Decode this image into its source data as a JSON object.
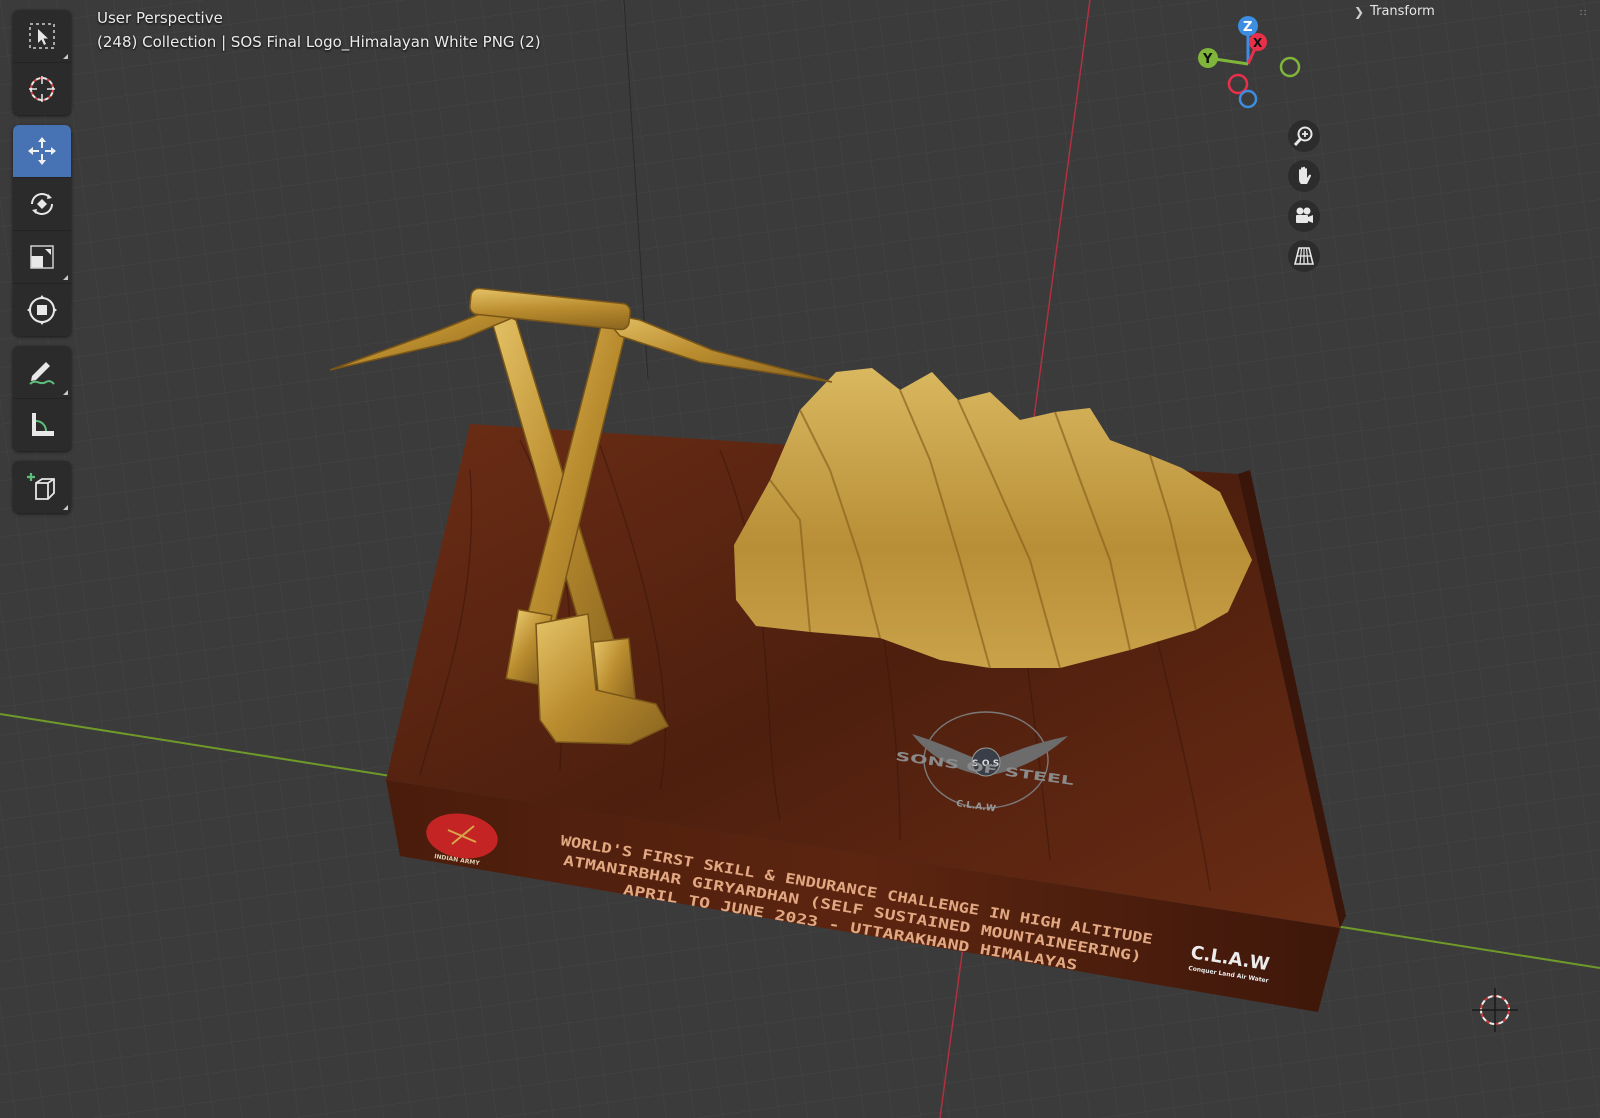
{
  "viewport": {
    "title": "User Perspective",
    "subtitle": "(248) Collection | SOS Final Logo_Himalayan White PNG (2)"
  },
  "toolbar": {
    "tools": [
      {
        "name": "select-box",
        "active": false
      },
      {
        "name": "cursor",
        "active": false
      },
      {
        "name": "move",
        "active": true
      },
      {
        "name": "rotate",
        "active": false
      },
      {
        "name": "scale",
        "active": false
      },
      {
        "name": "transform",
        "active": false
      },
      {
        "name": "annotate",
        "active": false
      },
      {
        "name": "measure",
        "active": false
      },
      {
        "name": "add-cube",
        "active": false
      }
    ]
  },
  "gizmo": {
    "z_label": "Z",
    "x_label": "X",
    "y_label": "Y",
    "colors": {
      "x": "#e8304a",
      "y": "#7fb63a",
      "z": "#3d8ee0"
    }
  },
  "nav": [
    "zoom-icon",
    "pan-hand-icon",
    "camera-icon",
    "grid-perspective-icon"
  ],
  "sidepanel": {
    "transform_label": "Transform"
  },
  "model": {
    "plaque_lines": [
      "WORLD'S FIRST SKILL & ENDURANCE CHALLENGE IN HIGH ALTITUDE",
      "ATMANIRBHAR GIRYARDHAN (SELF SUSTAINED MOUNTAINEERING)",
      "APRIL TO JUNE 2023 - UTTARAKHAND HIMALAYAS"
    ],
    "army_label": "INDIAN ARMY",
    "claw_title": "C.L.A.W",
    "claw_sub": "Conquer Land Air Water",
    "emblem_text": "SONS OF STEEL",
    "emblem_badge": "S.O.S",
    "emblem_bottom": "C.L.A.W",
    "colors": {
      "wood": "#5a2612",
      "gold": "#c8a040",
      "logo_red": "#c42424"
    }
  }
}
